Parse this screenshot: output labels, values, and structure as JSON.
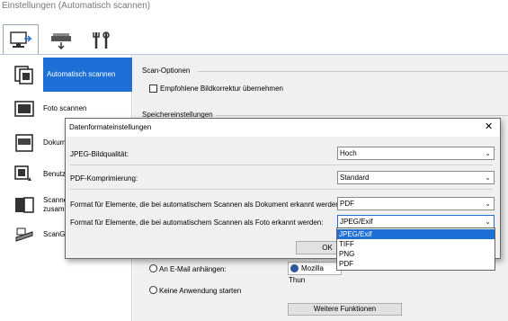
{
  "window": {
    "title": "Einstellungen (Automatisch scannen)"
  },
  "sidebar": {
    "items": [
      {
        "label": "Automatisch scannen",
        "icon": "auto-scan-icon"
      },
      {
        "label": "Foto scannen",
        "icon": "photo-scan-icon"
      },
      {
        "label": "Dokument scannen",
        "icon": "document-scan-icon"
      },
      {
        "label": "Benutzerdefiniert scannen",
        "icon": "custom-scan-icon"
      },
      {
        "label": "Scannen und zusammenfügen",
        "icon": "stitch-scan-icon"
      },
      {
        "label": "ScanGear",
        "icon": "scangear-icon"
      }
    ],
    "visible_labels": [
      "Automatisch scannen",
      "Foto scannen",
      "Dokum",
      "Benutz",
      "Scanne",
      "zusam",
      "ScanGe"
    ]
  },
  "main": {
    "scan_options_header": "Scan-Optionen",
    "auto_correct_label": "Empfohlene Bildkorrektur übernehmen",
    "save_settings_header": "Speichereinstellungen",
    "email_label": "An E-Mail anhängen:",
    "email_app": "Mozilla Thunderbird",
    "email_app_visible": "Mozilla Thun",
    "no_app_label": "Keine Anwendung starten",
    "more_functions_button": "Weitere Funktionen"
  },
  "dialog": {
    "title": "Datenformateinstellungen",
    "close_glyph": "✕",
    "rows": [
      {
        "label": "JPEG-Bildqualität:",
        "value": "Hoch"
      },
      {
        "label": "PDF-Komprimierung:",
        "value": "Standard"
      },
      {
        "label": "Format für Elemente, die bei automatischem Scannen als Dokument erkannt werden:",
        "value": "PDF"
      },
      {
        "label": "Format für Elemente, die bei automatischem Scannen als Foto erkannt werden:",
        "value": "JPEG/Exif"
      }
    ],
    "ok_button": "OK",
    "dropdown_options": [
      "JPEG/Exif",
      "TIFF",
      "PNG",
      "PDF"
    ],
    "dropdown_selected": "JPEG/Exif"
  },
  "colors": {
    "accent": "#1e6fd6",
    "dialog_bg": "#f0f0f0"
  }
}
